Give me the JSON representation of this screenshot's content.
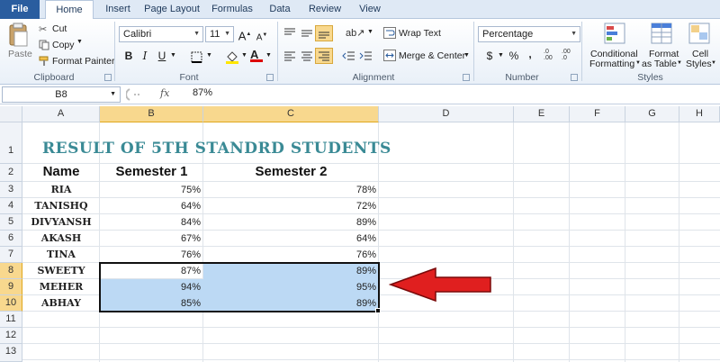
{
  "tabs": [
    "File",
    "Home",
    "Insert",
    "Page Layout",
    "Formulas",
    "Data",
    "Review",
    "View"
  ],
  "clipboard": {
    "paste": "Paste",
    "cut": "Cut",
    "copy": "Copy",
    "format_painter": "Format Painter",
    "label": "Clipboard"
  },
  "font": {
    "family": "Calibri",
    "size": "11",
    "label": "Font"
  },
  "alignment": {
    "wrap_text": "Wrap Text",
    "merge_center": "Merge & Center",
    "label": "Alignment"
  },
  "number": {
    "format": "Percentage",
    "label": "Number",
    "currency": "$",
    "percent": "%",
    "comma": ","
  },
  "styles": {
    "conditional": "Conditional",
    "formatting": "Formatting",
    "format": "Format",
    "as_table": "as Table",
    "cell": "Cell",
    "cell_styles": "Styles",
    "label": "Styles"
  },
  "formula_bar": {
    "cell_ref": "B8",
    "fx": "fx",
    "value": "87%"
  },
  "columns": [
    "A",
    "B",
    "C",
    "D",
    "E",
    "F",
    "G",
    "H"
  ],
  "rows": [
    "1",
    "2",
    "3",
    "4",
    "5",
    "6",
    "7",
    "8",
    "9",
    "10",
    "11",
    "12",
    "13"
  ],
  "sheet": {
    "title": "RESULT OF 5TH STANDRD STUDENTS",
    "headers": {
      "name": "Name",
      "sem1": "Semester 1",
      "sem2": "Semester 2"
    },
    "students": [
      {
        "name": "RIA",
        "sem1": "75%",
        "sem2": "78%"
      },
      {
        "name": "TANISHQ",
        "sem1": "64%",
        "sem2": "72%"
      },
      {
        "name": "DIVYANSH",
        "sem1": "84%",
        "sem2": "89%"
      },
      {
        "name": "AKASH",
        "sem1": "67%",
        "sem2": "64%"
      },
      {
        "name": "TINA",
        "sem1": "76%",
        "sem2": "76%"
      },
      {
        "name": "SWEETY",
        "sem1": "87%",
        "sem2": "89%"
      },
      {
        "name": "MEHER",
        "sem1": "94%",
        "sem2": "95%"
      },
      {
        "name": "ABHAY",
        "sem1": "85%",
        "sem2": "89%"
      }
    ]
  },
  "colors": {
    "accent": "#2a5d9f",
    "selection": "#bcd9f4",
    "title": "#3a8a95",
    "arrow": "#e01f1f",
    "header_highlight": "#f8d88e"
  }
}
